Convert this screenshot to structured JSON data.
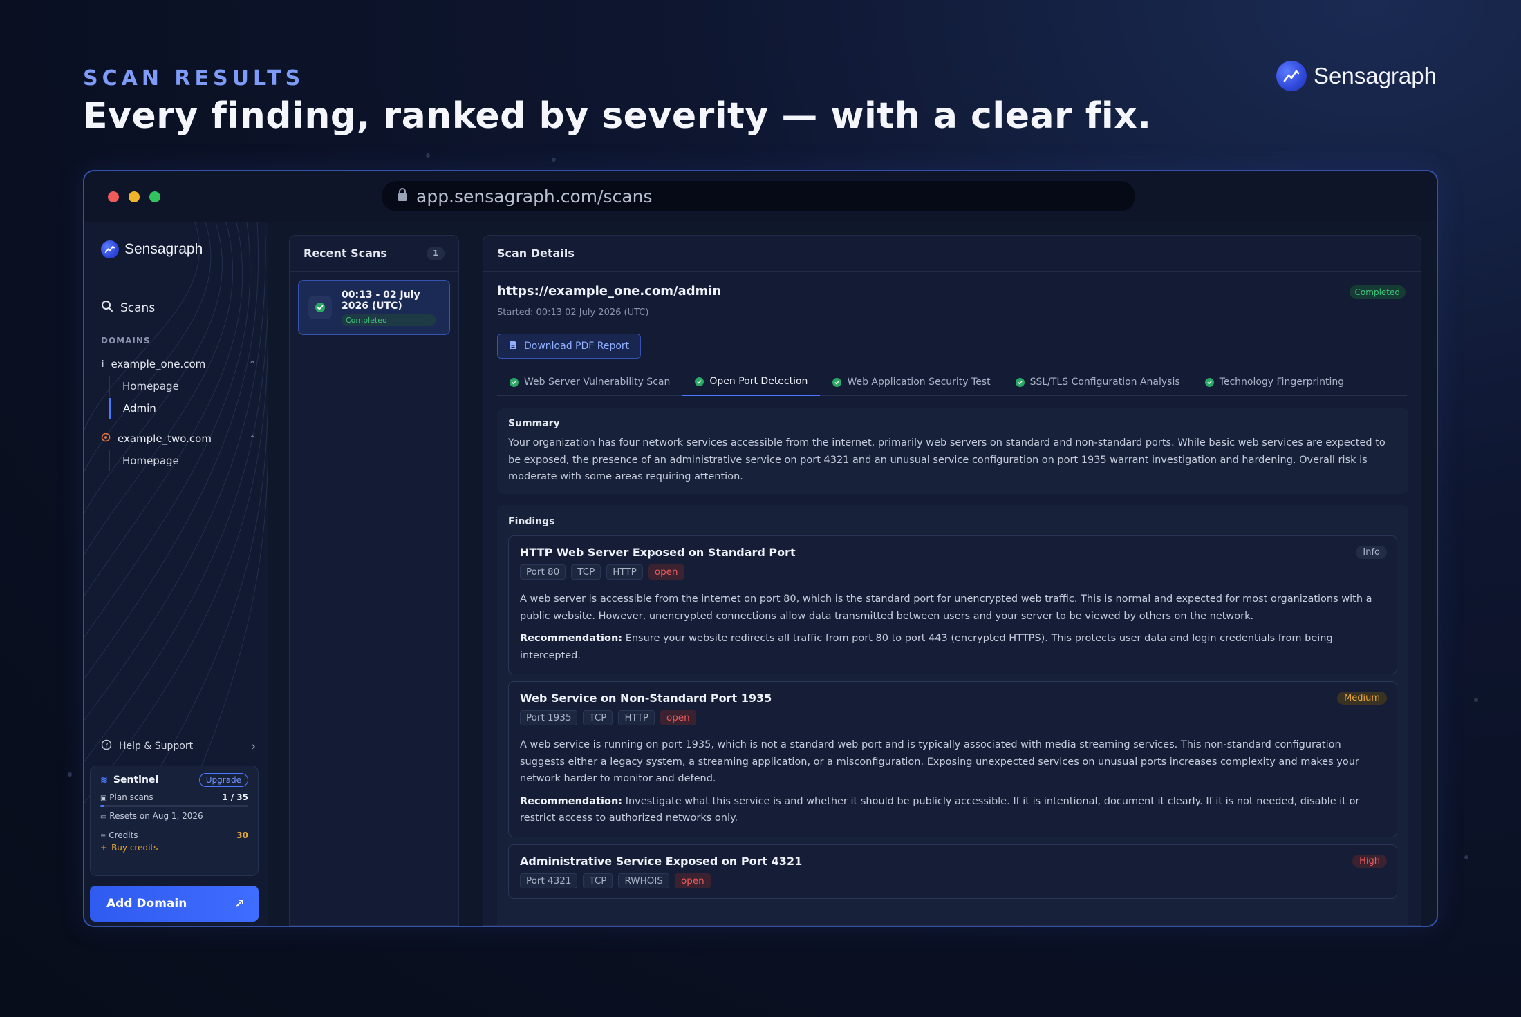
{
  "hero": {
    "eyebrow": "SCAN RESULTS",
    "headline": "Every finding, ranked by severity — with a clear fix.",
    "brand": "Sensagraph"
  },
  "browser": {
    "url": "app.sensagraph.com/scans"
  },
  "sidebar": {
    "brand": "Sensagraph",
    "scans_label": "Scans",
    "domains_label": "DOMAINS",
    "domains": [
      {
        "name": "example_one.com",
        "pages": [
          "Homepage",
          "Admin"
        ],
        "active_page": "Admin"
      },
      {
        "name": "example_two.com",
        "pages": [
          "Homepage"
        ]
      }
    ],
    "help_label": "Help & Support",
    "plan": {
      "name": "Sentinel",
      "upgrade_label": "Upgrade",
      "plan_scans_label": "Plan scans",
      "plan_scans_value": "1 / 35",
      "plan_scans_fraction": 0.03,
      "resets_label": "Resets on Aug 1, 2026",
      "credits_label": "Credits",
      "credits_value": "30",
      "buy_label": "Buy credits"
    },
    "add_domain_label": "Add Domain"
  },
  "recent": {
    "title": "Recent Scans",
    "count": "1",
    "items": [
      {
        "time": "00:13 - 02 July 2026 (UTC)",
        "status": "Completed"
      }
    ]
  },
  "details": {
    "title": "Scan Details",
    "url": "https://example_one.com/admin",
    "started": "Started: 00:13 02 July 2026 (UTC)",
    "status": "Completed",
    "pdf_label": "Download PDF Report",
    "tabs": [
      "Web Server Vulnerability Scan",
      "Open Port Detection",
      "Web Application Security Test",
      "SSL/TLS Configuration Analysis",
      "Technology Fingerprinting"
    ],
    "active_tab": "Open Port Detection",
    "summary_title": "Summary",
    "summary": "Your organization has four network services accessible from the internet, primarily web servers on standard and non-standard ports. While basic web services are expected to be exposed, the presence of an administrative service on port 4321 and an unusual service configuration on port 1935 warrant investigation and hardening. Overall risk is moderate with some areas requiring attention.",
    "findings_title": "Findings",
    "rec_label": "Recommendation:",
    "findings": [
      {
        "title": "HTTP Web Server Exposed on Standard Port",
        "severity": "Info",
        "tags": [
          "Port 80",
          "TCP",
          "HTTP"
        ],
        "state": "open",
        "description": "A web server is accessible from the internet on port 80, which is the standard port for unencrypted web traffic. This is normal and expected for most organizations with a public website. However, unencrypted connections allow data transmitted between users and your server to be viewed by others on the network.",
        "recommendation": "Ensure your website redirects all traffic from port 80 to port 443 (encrypted HTTPS). This protects user data and login credentials from being intercepted."
      },
      {
        "title": "Web Service on Non-Standard Port 1935",
        "severity": "Medium",
        "tags": [
          "Port 1935",
          "TCP",
          "HTTP"
        ],
        "state": "open",
        "description": "A web service is running on port 1935, which is not a standard web port and is typically associated with media streaming services. This non-standard configuration suggests either a legacy system, a streaming application, or a misconfiguration. Exposing unexpected services on unusual ports increases complexity and makes your network harder to monitor and defend.",
        "recommendation": "Investigate what this service is and whether it should be publicly accessible. If it is intentional, document it clearly. If it is not needed, disable it or restrict access to authorized networks only."
      },
      {
        "title": "Administrative Service Exposed on Port 4321",
        "severity": "High",
        "tags": [
          "Port 4321",
          "TCP",
          "RWHOIS"
        ],
        "state": "open"
      }
    ]
  },
  "colors": {
    "accent": "#4a78ff",
    "success": "#3ec77a",
    "medium": "#e8a83a",
    "high": "#ef5a5a"
  }
}
